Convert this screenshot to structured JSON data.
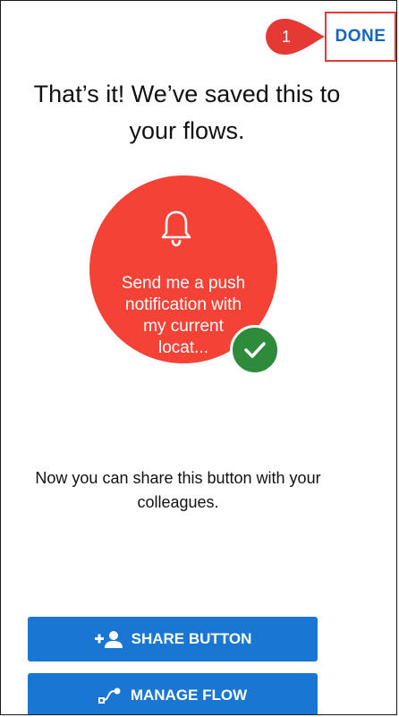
{
  "header": {
    "done_label": "DONE",
    "callout_number": "1"
  },
  "main": {
    "heading": "That’s it! We’ve saved this to your flows.",
    "flow_button_text": "Send me a push\nnotification with\nmy current\nlocat...",
    "share_info": "Now you can share this button with your\ncolleagues."
  },
  "actions": {
    "share_label": "SHARE BUTTON",
    "manage_label": "MANAGE FLOW"
  },
  "colors": {
    "accent": "#1976d2",
    "flow_circle": "#f44336",
    "success": "#2e8b3c",
    "highlight": "#e53935"
  },
  "icons": [
    "bell-icon",
    "checkmark-icon",
    "add-person-icon",
    "flow-icon"
  ]
}
